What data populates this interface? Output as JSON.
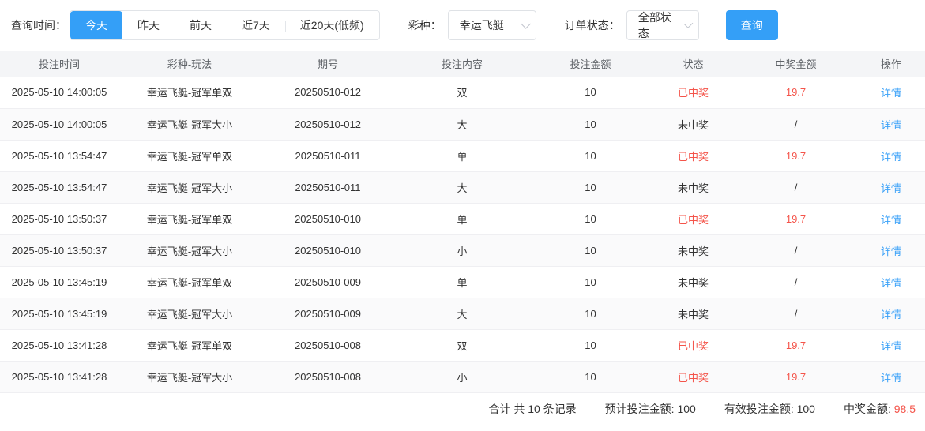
{
  "colors": {
    "accent_blue": "#349ff7",
    "status_red": "#f4544a",
    "header_bg": "#f4f5f7"
  },
  "filters": {
    "time_label": "查询时间：",
    "time_options": [
      {
        "label": "今天",
        "active": true
      },
      {
        "label": "昨天",
        "active": false
      },
      {
        "label": "前天",
        "active": false
      },
      {
        "label": "近7天",
        "active": false
      },
      {
        "label": "近20天(低频)",
        "active": false
      }
    ],
    "lottery_label": "彩种：",
    "lottery_value": "幸运飞艇",
    "status_label": "订单状态：",
    "status_value": "全部状态",
    "query_button": "查询"
  },
  "table": {
    "columns": [
      "投注时间",
      "彩种-玩法",
      "期号",
      "投注内容",
      "投注金额",
      "状态",
      "中奖金额",
      "操作"
    ],
    "detail_label": "详情",
    "rows": [
      {
        "time": "2025-05-10 14:00:05",
        "play": "幸运飞艇-冠军单双",
        "issue": "20250510-012",
        "content": "双",
        "amount": "10",
        "status": "已中奖",
        "won": true,
        "prize": "19.7"
      },
      {
        "time": "2025-05-10 14:00:05",
        "play": "幸运飞艇-冠军大小",
        "issue": "20250510-012",
        "content": "大",
        "amount": "10",
        "status": "未中奖",
        "won": false,
        "prize": "/"
      },
      {
        "time": "2025-05-10 13:54:47",
        "play": "幸运飞艇-冠军单双",
        "issue": "20250510-011",
        "content": "单",
        "amount": "10",
        "status": "已中奖",
        "won": true,
        "prize": "19.7"
      },
      {
        "time": "2025-05-10 13:54:47",
        "play": "幸运飞艇-冠军大小",
        "issue": "20250510-011",
        "content": "大",
        "amount": "10",
        "status": "未中奖",
        "won": false,
        "prize": "/"
      },
      {
        "time": "2025-05-10 13:50:37",
        "play": "幸运飞艇-冠军单双",
        "issue": "20250510-010",
        "content": "单",
        "amount": "10",
        "status": "已中奖",
        "won": true,
        "prize": "19.7"
      },
      {
        "time": "2025-05-10 13:50:37",
        "play": "幸运飞艇-冠军大小",
        "issue": "20250510-010",
        "content": "小",
        "amount": "10",
        "status": "未中奖",
        "won": false,
        "prize": "/"
      },
      {
        "time": "2025-05-10 13:45:19",
        "play": "幸运飞艇-冠军单双",
        "issue": "20250510-009",
        "content": "单",
        "amount": "10",
        "status": "未中奖",
        "won": false,
        "prize": "/"
      },
      {
        "time": "2025-05-10 13:45:19",
        "play": "幸运飞艇-冠军大小",
        "issue": "20250510-009",
        "content": "大",
        "amount": "10",
        "status": "未中奖",
        "won": false,
        "prize": "/"
      },
      {
        "time": "2025-05-10 13:41:28",
        "play": "幸运飞艇-冠军单双",
        "issue": "20250510-008",
        "content": "双",
        "amount": "10",
        "status": "已中奖",
        "won": true,
        "prize": "19.7"
      },
      {
        "time": "2025-05-10 13:41:28",
        "play": "幸运飞艇-冠军大小",
        "issue": "20250510-008",
        "content": "小",
        "amount": "10",
        "status": "已中奖",
        "won": true,
        "prize": "19.7"
      }
    ]
  },
  "footer": {
    "total_text": "合计 共 10 条记录",
    "expected_label": "预计投注金额:",
    "expected_value": "100",
    "valid_label": "有效投注金额:",
    "valid_value": "100",
    "prize_label": "中奖金额:",
    "prize_value": "98.5"
  }
}
